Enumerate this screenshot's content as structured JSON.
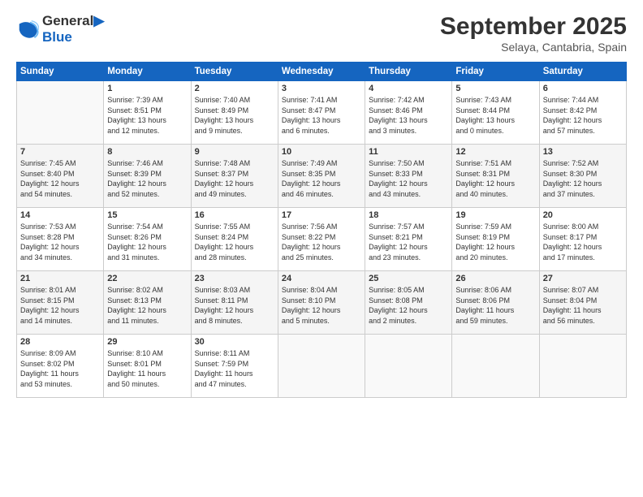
{
  "header": {
    "logo_line1": "General",
    "logo_line2": "Blue",
    "month": "September 2025",
    "location": "Selaya, Cantabria, Spain"
  },
  "days_of_week": [
    "Sunday",
    "Monday",
    "Tuesday",
    "Wednesday",
    "Thursday",
    "Friday",
    "Saturday"
  ],
  "weeks": [
    [
      {
        "day": "",
        "info": ""
      },
      {
        "day": "1",
        "info": "Sunrise: 7:39 AM\nSunset: 8:51 PM\nDaylight: 13 hours\nand 12 minutes."
      },
      {
        "day": "2",
        "info": "Sunrise: 7:40 AM\nSunset: 8:49 PM\nDaylight: 13 hours\nand 9 minutes."
      },
      {
        "day": "3",
        "info": "Sunrise: 7:41 AM\nSunset: 8:47 PM\nDaylight: 13 hours\nand 6 minutes."
      },
      {
        "day": "4",
        "info": "Sunrise: 7:42 AM\nSunset: 8:46 PM\nDaylight: 13 hours\nand 3 minutes."
      },
      {
        "day": "5",
        "info": "Sunrise: 7:43 AM\nSunset: 8:44 PM\nDaylight: 13 hours\nand 0 minutes."
      },
      {
        "day": "6",
        "info": "Sunrise: 7:44 AM\nSunset: 8:42 PM\nDaylight: 12 hours\nand 57 minutes."
      }
    ],
    [
      {
        "day": "7",
        "info": "Sunrise: 7:45 AM\nSunset: 8:40 PM\nDaylight: 12 hours\nand 54 minutes."
      },
      {
        "day": "8",
        "info": "Sunrise: 7:46 AM\nSunset: 8:39 PM\nDaylight: 12 hours\nand 52 minutes."
      },
      {
        "day": "9",
        "info": "Sunrise: 7:48 AM\nSunset: 8:37 PM\nDaylight: 12 hours\nand 49 minutes."
      },
      {
        "day": "10",
        "info": "Sunrise: 7:49 AM\nSunset: 8:35 PM\nDaylight: 12 hours\nand 46 minutes."
      },
      {
        "day": "11",
        "info": "Sunrise: 7:50 AM\nSunset: 8:33 PM\nDaylight: 12 hours\nand 43 minutes."
      },
      {
        "day": "12",
        "info": "Sunrise: 7:51 AM\nSunset: 8:31 PM\nDaylight: 12 hours\nand 40 minutes."
      },
      {
        "day": "13",
        "info": "Sunrise: 7:52 AM\nSunset: 8:30 PM\nDaylight: 12 hours\nand 37 minutes."
      }
    ],
    [
      {
        "day": "14",
        "info": "Sunrise: 7:53 AM\nSunset: 8:28 PM\nDaylight: 12 hours\nand 34 minutes."
      },
      {
        "day": "15",
        "info": "Sunrise: 7:54 AM\nSunset: 8:26 PM\nDaylight: 12 hours\nand 31 minutes."
      },
      {
        "day": "16",
        "info": "Sunrise: 7:55 AM\nSunset: 8:24 PM\nDaylight: 12 hours\nand 28 minutes."
      },
      {
        "day": "17",
        "info": "Sunrise: 7:56 AM\nSunset: 8:22 PM\nDaylight: 12 hours\nand 25 minutes."
      },
      {
        "day": "18",
        "info": "Sunrise: 7:57 AM\nSunset: 8:21 PM\nDaylight: 12 hours\nand 23 minutes."
      },
      {
        "day": "19",
        "info": "Sunrise: 7:59 AM\nSunset: 8:19 PM\nDaylight: 12 hours\nand 20 minutes."
      },
      {
        "day": "20",
        "info": "Sunrise: 8:00 AM\nSunset: 8:17 PM\nDaylight: 12 hours\nand 17 minutes."
      }
    ],
    [
      {
        "day": "21",
        "info": "Sunrise: 8:01 AM\nSunset: 8:15 PM\nDaylight: 12 hours\nand 14 minutes."
      },
      {
        "day": "22",
        "info": "Sunrise: 8:02 AM\nSunset: 8:13 PM\nDaylight: 12 hours\nand 11 minutes."
      },
      {
        "day": "23",
        "info": "Sunrise: 8:03 AM\nSunset: 8:11 PM\nDaylight: 12 hours\nand 8 minutes."
      },
      {
        "day": "24",
        "info": "Sunrise: 8:04 AM\nSunset: 8:10 PM\nDaylight: 12 hours\nand 5 minutes."
      },
      {
        "day": "25",
        "info": "Sunrise: 8:05 AM\nSunset: 8:08 PM\nDaylight: 12 hours\nand 2 minutes."
      },
      {
        "day": "26",
        "info": "Sunrise: 8:06 AM\nSunset: 8:06 PM\nDaylight: 11 hours\nand 59 minutes."
      },
      {
        "day": "27",
        "info": "Sunrise: 8:07 AM\nSunset: 8:04 PM\nDaylight: 11 hours\nand 56 minutes."
      }
    ],
    [
      {
        "day": "28",
        "info": "Sunrise: 8:09 AM\nSunset: 8:02 PM\nDaylight: 11 hours\nand 53 minutes."
      },
      {
        "day": "29",
        "info": "Sunrise: 8:10 AM\nSunset: 8:01 PM\nDaylight: 11 hours\nand 50 minutes."
      },
      {
        "day": "30",
        "info": "Sunrise: 8:11 AM\nSunset: 7:59 PM\nDaylight: 11 hours\nand 47 minutes."
      },
      {
        "day": "",
        "info": ""
      },
      {
        "day": "",
        "info": ""
      },
      {
        "day": "",
        "info": ""
      },
      {
        "day": "",
        "info": ""
      }
    ]
  ]
}
